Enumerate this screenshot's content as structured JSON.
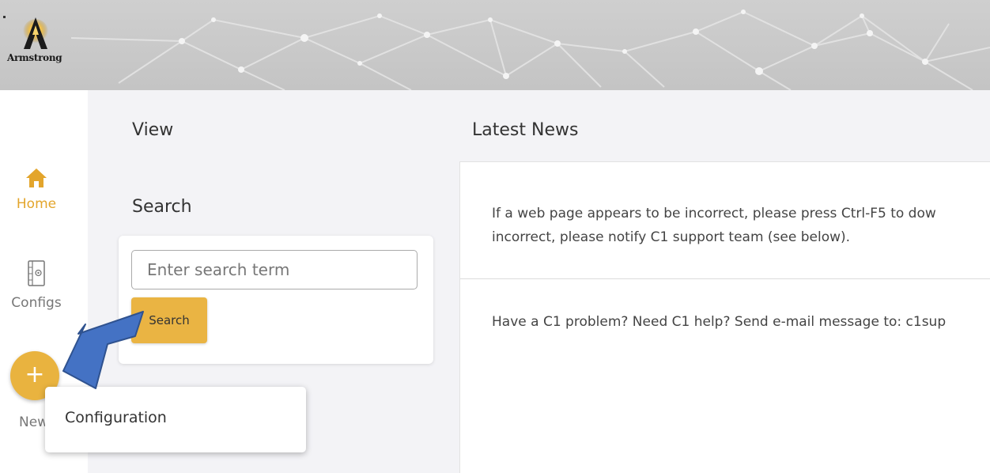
{
  "brand": {
    "logo_text": "Armstrong"
  },
  "sidebar": {
    "items": [
      {
        "label": "Home",
        "icon": "home-icon",
        "active": true
      },
      {
        "label": "Configs",
        "icon": "config-book-icon",
        "active": false
      }
    ],
    "new_button": {
      "symbol": "+",
      "label": "New"
    }
  },
  "view_section": {
    "title": "View"
  },
  "search": {
    "title": "Search",
    "placeholder": "Enter search term",
    "button_label": "Search"
  },
  "news": {
    "title": "Latest News",
    "items": [
      {
        "line1": "If a web page appears to be incorrect, please press Ctrl-F5 to dow",
        "line2": "incorrect, please notify C1 support team (see below)."
      },
      {
        "line1": "Have a C1 problem? Need C1 help? Send e-mail message to: c1sup"
      }
    ]
  },
  "popup_menu": {
    "items": [
      "Configuration"
    ]
  },
  "colors": {
    "accent": "#e9b33f",
    "home_active": "#e3a52c",
    "arrow": "#4472c4",
    "main_bg": "#f3f3f6"
  }
}
